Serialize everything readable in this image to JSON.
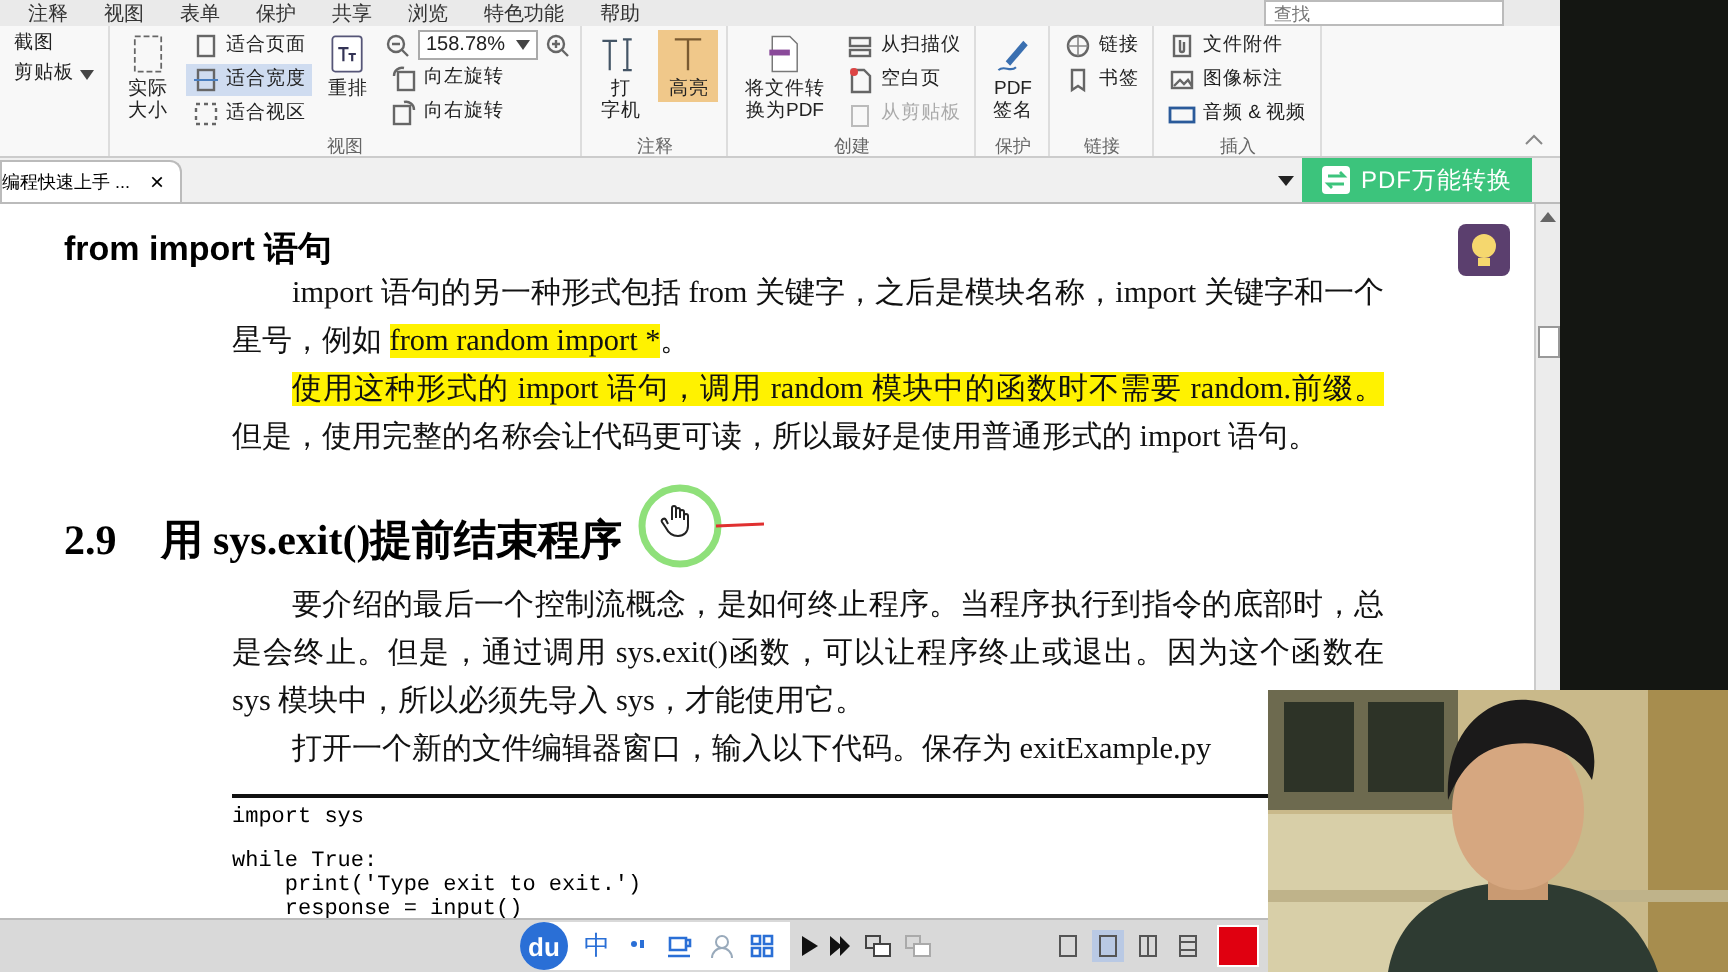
{
  "menu_tabs": [
    "注释",
    "视图",
    "表单",
    "保护",
    "共享",
    "浏览",
    "特色功能",
    "帮助"
  ],
  "search": {
    "placeholder": "查找"
  },
  "ribbon": {
    "groups": [
      {
        "columns": [
          [
            {
              "kind": "small",
              "label_lines": [
                "截图"
              ],
              "selected": false,
              "disabled": false,
              "has_menu": false
            },
            {
              "kind": "small",
              "label_lines": [
                "剪贴板"
              ],
              "selected": false,
              "disabled": false,
              "has_menu": true
            }
          ]
        ]
      },
      {
        "label": "视图",
        "columns": [
          [
            {
              "kind": "large",
              "label_lines": [
                "实际",
                "大小"
              ],
              "selected": false,
              "disabled": false,
              "has_menu": false
            }
          ],
          [
            {
              "kind": "small",
              "label_lines": [
                "适合页面"
              ],
              "selected": false,
              "disabled": false,
              "has_menu": false
            },
            {
              "kind": "small",
              "label_lines": [
                "适合宽度"
              ],
              "selected": true,
              "disabled": false,
              "has_menu": false
            },
            {
              "kind": "small",
              "label_lines": [
                "适合视区"
              ],
              "selected": false,
              "disabled": false,
              "has_menu": false
            }
          ],
          [
            {
              "kind": "large",
              "label_lines": [
                "重排"
              ],
              "selected": false,
              "disabled": false,
              "has_menu": false
            }
          ],
          [
            {
              "kind": "zoom",
              "value": "158.78%"
            },
            {
              "kind": "small",
              "label_lines": [
                "向左旋转"
              ],
              "selected": false,
              "disabled": false,
              "has_menu": false
            },
            {
              "kind": "small",
              "label_lines": [
                "向右旋转"
              ],
              "selected": false,
              "disabled": false,
              "has_menu": false
            }
          ]
        ]
      },
      {
        "label": "注释",
        "columns": [
          [
            {
              "kind": "large",
              "label_lines": [
                "打",
                "字机"
              ],
              "selected": false,
              "disabled": false,
              "has_menu": false
            }
          ],
          [
            {
              "kind": "large",
              "label_lines": [
                "高亮"
              ],
              "selected": true,
              "disabled": false,
              "has_menu": false
            }
          ]
        ]
      },
      {
        "label": "创建",
        "columns": [
          [
            {
              "kind": "large",
              "label_lines": [
                "将文件转",
                "换为PDF"
              ],
              "selected": false,
              "disabled": false,
              "has_menu": false
            }
          ],
          [
            {
              "kind": "small",
              "label_lines": [
                "从扫描仪"
              ],
              "selected": false,
              "disabled": false,
              "has_menu": false
            },
            {
              "kind": "small",
              "label_lines": [
                "空白页"
              ],
              "selected": false,
              "disabled": false,
              "has_menu": false
            },
            {
              "kind": "small",
              "label_lines": [
                "从剪贴板"
              ],
              "selected": false,
              "disabled": true,
              "has_menu": false
            }
          ]
        ]
      },
      {
        "label": "保护",
        "columns": [
          [
            {
              "kind": "large",
              "label_lines": [
                "PDF",
                "签名"
              ],
              "selected": false,
              "disabled": false,
              "has_menu": false
            }
          ]
        ]
      },
      {
        "label": "链接",
        "columns": [
          [
            {
              "kind": "small",
              "label_lines": [
                "链接"
              ],
              "selected": false,
              "disabled": false,
              "has_menu": false
            },
            {
              "kind": "small",
              "label_lines": [
                "书签"
              ],
              "selected": false,
              "disabled": false,
              "has_menu": false
            }
          ]
        ]
      },
      {
        "label": "插入",
        "columns": [
          [
            {
              "kind": "small",
              "label_lines": [
                "文件附件"
              ],
              "selected": false,
              "disabled": false,
              "has_menu": false
            },
            {
              "kind": "small",
              "label_lines": [
                "图像标注"
              ],
              "selected": false,
              "disabled": false,
              "has_menu": false
            },
            {
              "kind": "small",
              "label_lines": [
                "音频 & 视频"
              ],
              "selected": false,
              "disabled": false,
              "has_menu": false
            }
          ]
        ]
      }
    ]
  },
  "document_tab": {
    "title": "编程快速上手 ...",
    "close": "×"
  },
  "convert_button": {
    "label": "PDF万能转换"
  },
  "page": {
    "blocks": [
      {
        "kind": "heading",
        "text": "from import 语句"
      },
      {
        "kind": "paragraph",
        "segments": [
          {
            "text": "import 语句的另一种形式包括 from 关键字，之后是模块名称，import 关键字和一个星号，例如 ",
            "highlight": false
          },
          {
            "text": "from random import *",
            "highlight": true
          },
          {
            "text": "。",
            "highlight": false
          }
        ]
      },
      {
        "kind": "paragraph",
        "segments": [
          {
            "text": "使用这种形式的 import 语句，调用 random 模块中的函数时不需要 random.前缀。",
            "highlight": true
          },
          {
            "text": "但是，使用完整的名称会让代码更可读，所以最好是使用普通形式的 import 语句。",
            "highlight": false
          }
        ]
      },
      {
        "kind": "section",
        "number": "2.9",
        "title": "用 sys.exit()提前结束程序"
      },
      {
        "kind": "paragraph",
        "segments": [
          {
            "text": "要介绍的最后一个控制流概念，是如何终止程序。当程序执行到指令的底部时，总是会终止。但是，通过调用 sys.exit()函数，可以让程序终止或退出。因为这个函数在 sys 模块中，所以必须先导入 sys，才能使用它。",
            "highlight": false
          }
        ]
      },
      {
        "kind": "paragraph",
        "segments": [
          {
            "text": "打开一个新的文件编辑器窗口，输入以下代码。保存为 exitExample.py",
            "highlight": false
          }
        ]
      },
      {
        "kind": "code",
        "line_groups": [
          [
            "import sys"
          ],
          [
            "while True:",
            "    print('Type exit to exit.')",
            "    response = input()"
          ]
        ]
      }
    ]
  },
  "ime_toolbar": {
    "logo": "du",
    "mode": "中"
  },
  "page_views": [
    {
      "selected": false
    },
    {
      "selected": true
    },
    {
      "selected": false
    },
    {
      "selected": false
    }
  ]
}
